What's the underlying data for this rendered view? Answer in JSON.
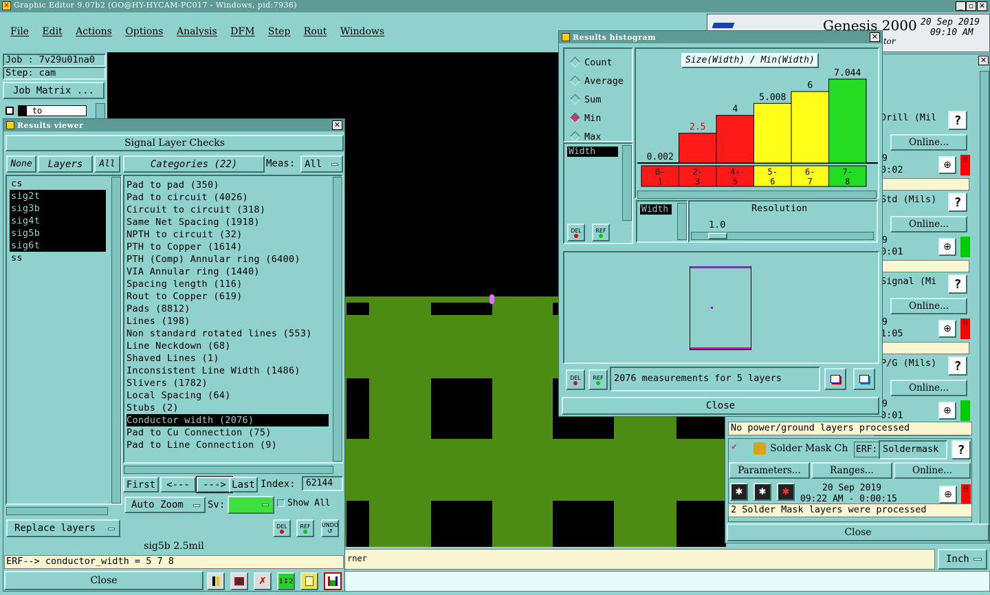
{
  "window_title": "Graphic Editor 9.07b2 (OO@HY-HYCAM-PC017 - Windows, pid:7936)",
  "menu": [
    "File",
    "Edit",
    "Actions",
    "Options",
    "Analysis",
    "DFM",
    "Step",
    "Rout",
    "Windows"
  ],
  "job": {
    "job_label": "Job : 7v29u01na0",
    "step_label": "Step: cam",
    "matrix_button": "Job Matrix ...",
    "to_label": "to"
  },
  "genesis": {
    "title": "Genesis 2000",
    "subtitle": "itor",
    "date": "20 Sep 2019",
    "time": "09:10 AM"
  },
  "results_viewer": {
    "title": "Results viewer",
    "header": "Signal Layer Checks",
    "none_btn": "None",
    "layers_btn": "Layers",
    "all_btn": "All",
    "categories_btn": "Categories (22)",
    "meas_label": "Meas:",
    "meas_value": "All",
    "layers": [
      {
        "name": "cs",
        "selected": false
      },
      {
        "name": "sig2t",
        "selected": true
      },
      {
        "name": "sig3b",
        "selected": true
      },
      {
        "name": "sig4t",
        "selected": true
      },
      {
        "name": "sig5b",
        "selected": true
      },
      {
        "name": "sig6t",
        "selected": true
      },
      {
        "name": "ss",
        "selected": false
      }
    ],
    "categories": [
      {
        "label": "Pad to pad (350)",
        "selected": false
      },
      {
        "label": "Pad to circuit (4026)",
        "selected": false
      },
      {
        "label": "Circuit to circuit (318)",
        "selected": false
      },
      {
        "label": "Same Net Spacing (1918)",
        "selected": false
      },
      {
        "label": "NPTH to circuit (32)",
        "selected": false
      },
      {
        "label": "PTH to Copper (1614)",
        "selected": false
      },
      {
        "label": "PTH (Comp) Annular ring (6400)",
        "selected": false
      },
      {
        "label": "VIA Annular ring (1440)",
        "selected": false
      },
      {
        "label": "Spacing length (116)",
        "selected": false
      },
      {
        "label": "Rout to Copper (619)",
        "selected": false
      },
      {
        "label": "Pads (8812)",
        "selected": false
      },
      {
        "label": "Lines (198)",
        "selected": false
      },
      {
        "label": "Non standard rotated lines (553)",
        "selected": false
      },
      {
        "label": "Line Neckdown (68)",
        "selected": false
      },
      {
        "label": "Shaved Lines (1)",
        "selected": false
      },
      {
        "label": "Inconsistent Line Width (1486)",
        "selected": false
      },
      {
        "label": "Slivers (1782)",
        "selected": false
      },
      {
        "label": "Local Spacing (64)",
        "selected": false
      },
      {
        "label": "Stubs (2)",
        "selected": false
      },
      {
        "label": "Conductor width (2076)",
        "selected": true
      },
      {
        "label": "Pad to Cu Connection (75)",
        "selected": false
      },
      {
        "label": "Pad to Line Connection (9)",
        "selected": false
      }
    ],
    "nav": {
      "first": "First",
      "prev": "<---",
      "next": "--->",
      "last": "Last",
      "index_label": "Index:",
      "index_value": "62144"
    },
    "auto_zoom": "Auto Zoom",
    "sv_label": "Sv:",
    "show_all": "Show All",
    "replace_layers": "Replace layers",
    "status_line": "sig5b 2.5mil",
    "erf_line": "ERF--> conductor_width = 5 7 8",
    "close": "Close",
    "del": "DEL",
    "ref": "REF",
    "undo": "UNDO"
  },
  "histogram": {
    "title": "Results histogram",
    "modes": [
      {
        "label": "Count",
        "on": false
      },
      {
        "label": "Average",
        "on": false
      },
      {
        "label": "Sum",
        "on": false
      },
      {
        "label": "Min",
        "on": true
      },
      {
        "label": "Max",
        "on": false
      }
    ],
    "field": "Width",
    "field2": "Width",
    "resolution_label": "Resolution",
    "resolution_value": "1.0",
    "measurements_text": "2076 measurements for 5 layers",
    "close": "Close",
    "del": "DEL",
    "ref": "REF"
  },
  "chart_data": {
    "type": "bar",
    "title": "Size(Width) / Min(Width)",
    "categories": [
      "0-1",
      "2-3",
      "4-5",
      "5-6",
      "6-7",
      "7-8"
    ],
    "values": [
      0.002,
      2.5,
      4,
      5.008,
      6,
      7.044
    ],
    "value_labels": [
      "0.002",
      "2.5",
      "4",
      "5.008",
      "6",
      "7.044"
    ],
    "colors": [
      "#ff1a1a",
      "#ff1a1a",
      "#ff1a1a",
      "#ffff1a",
      "#ffff1a",
      "#22dd22"
    ],
    "ylim": [
      0,
      7.044
    ]
  },
  "checklist": {
    "rows": [
      {
        "name": "Drill (Mil",
        "online": "Online...",
        "time": "0:02"
      },
      {
        "name": "Std (Mils)",
        "online": "Online...",
        "time": "0:01"
      },
      {
        "name": "Signal (Mi",
        "online": "Online...",
        "time": "1:05"
      },
      {
        "name": "P/G (Mils)",
        "online": "Online...",
        "time": "0:01"
      }
    ],
    "pg_message": "No power/ground layers processed",
    "soldermask_name": "Solder Mask Ch",
    "erf_label": "ERF:",
    "erf_value": "Soldermask",
    "params_btn": "Parameters...",
    "ranges_btn": "Ranges...",
    "online_btn": "Online...",
    "sm_date": "20 Sep 2019",
    "sm_time": "09:22 AM - 0:00:15",
    "sm_message": "2 Solder Mask layers were processed",
    "close": "Close",
    "help": "?",
    "nine": "9"
  },
  "bottom": {
    "erf_partial": "rner",
    "units": "Inch"
  }
}
